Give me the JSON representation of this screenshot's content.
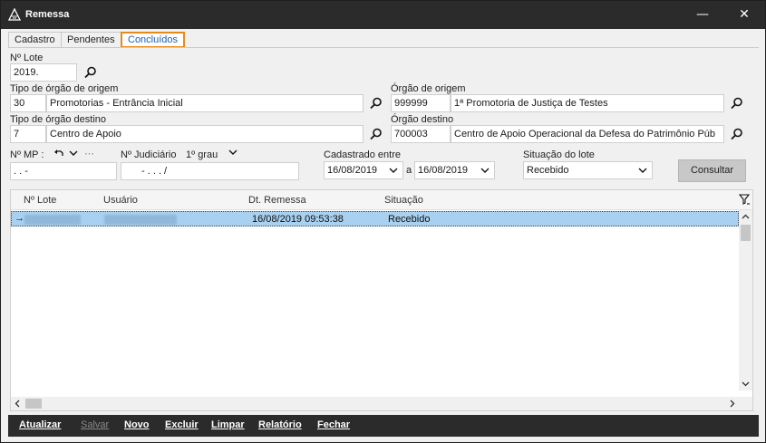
{
  "window": {
    "title": "Remessa"
  },
  "tabs": [
    {
      "label": "Cadastro"
    },
    {
      "label": "Pendentes"
    },
    {
      "label": "Concluídos"
    }
  ],
  "form": {
    "lote_label": "Nº Lote",
    "lote_value": "2019.",
    "tipo_origem_label": "Tipo de órgão de origem",
    "tipo_origem_code": "30",
    "tipo_origem_name": "Promotorias - Entrância Inicial",
    "orgao_origem_label": "Órgão de origem",
    "orgao_origem_code": "999999",
    "orgao_origem_name": "1ª Promotoria de Justiça de Testes",
    "tipo_destino_label": "Tipo de órgão destino",
    "tipo_destino_code": "7",
    "tipo_destino_name": "Centro de Apoio",
    "orgao_destino_label": "Órgão destino",
    "orgao_destino_code": "700003",
    "orgao_destino_name": "Centro de Apoio Operacional da Defesa do Patrimônio Púb",
    "mp_label": "Nº MP :",
    "mp_value": ".  .     -",
    "judiciario_label": "Nº Judiciário",
    "grau_label": "1º grau",
    "judiciario_value": "-  .  .  .    /",
    "cadastrado_label": "Cadastrado entre",
    "date_from": "16/08/2019",
    "date_sep": "a",
    "date_to": "16/08/2019",
    "situacao_label": "Situação do lote",
    "situacao_value": "Recebido",
    "consultar": "Consultar"
  },
  "grid": {
    "columns": [
      "Nº Lote",
      "Usuário",
      "Dt. Remessa",
      "Situação"
    ],
    "rows": [
      {
        "dt_remessa": "16/08/2019 09:53:38",
        "situacao": "Recebido"
      }
    ]
  },
  "toolbar": {
    "atualizar": "Atualizar",
    "salvar": "Salvar",
    "novo": "Novo",
    "excluir": "Excluir",
    "limpar": "Limpar",
    "relatorio": "Relatório",
    "fechar": "Fechar"
  },
  "colors": {
    "accent_tab": "#e88a1a",
    "selected_row": "#a8d0f0",
    "titlebar": "#2b2b2b"
  }
}
